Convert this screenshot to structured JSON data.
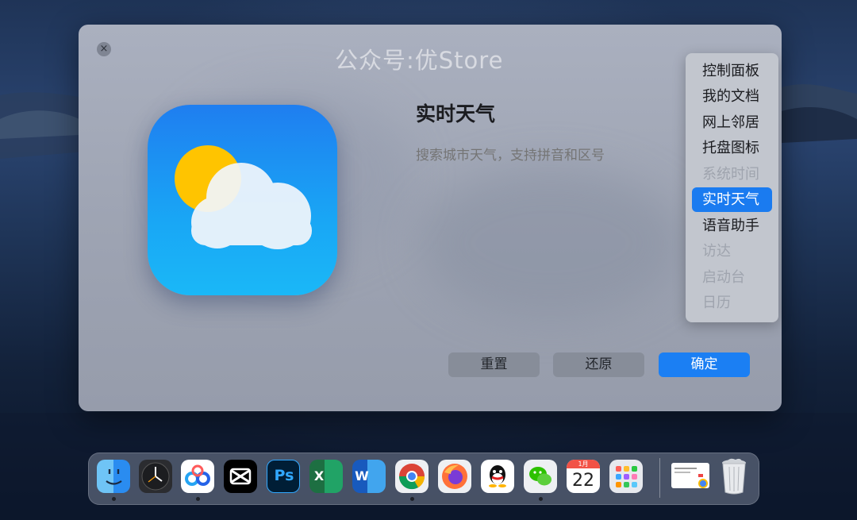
{
  "dialog": {
    "watermark": "公众号:优Store",
    "title": "实时天气",
    "search_placeholder": "搜索城市天气，支持拼音和区号",
    "buttons": {
      "reset": "重置",
      "restore": "还原",
      "ok": "确定"
    },
    "close_glyph": "×"
  },
  "menu": {
    "items": [
      {
        "label": "控制面板",
        "state": "normal"
      },
      {
        "label": "我的文档",
        "state": "normal"
      },
      {
        "label": "网上邻居",
        "state": "normal"
      },
      {
        "label": "托盘图标",
        "state": "normal"
      },
      {
        "label": "系统时间",
        "state": "disabled"
      },
      {
        "label": "实时天气",
        "state": "selected"
      },
      {
        "label": "语音助手",
        "state": "normal"
      },
      {
        "label": "访达",
        "state": "disabled"
      },
      {
        "label": "启动台",
        "state": "disabled"
      },
      {
        "label": "日历",
        "state": "disabled"
      }
    ]
  },
  "dock": {
    "apps": [
      {
        "icon": "finder-icon",
        "running": true
      },
      {
        "icon": "clock-icon",
        "running": false
      },
      {
        "icon": "baidu-netdisk-icon",
        "running": true
      },
      {
        "icon": "capcut-icon",
        "running": false
      },
      {
        "icon": "photoshop-icon",
        "label": "Ps",
        "running": false
      },
      {
        "icon": "excel-icon",
        "label": "X",
        "running": false
      },
      {
        "icon": "word-icon",
        "label": "W",
        "running": false
      },
      {
        "icon": "chrome-icon",
        "running": true
      },
      {
        "icon": "firefox-icon",
        "running": false
      },
      {
        "icon": "qq-icon",
        "running": false
      },
      {
        "icon": "wechat-icon",
        "running": true
      },
      {
        "icon": "calendar-icon",
        "month": "1月",
        "day": "22",
        "running": false
      },
      {
        "icon": "launchpad-icon",
        "running": false
      }
    ],
    "trailing": [
      {
        "icon": "document-preview-icon"
      },
      {
        "icon": "trash-icon"
      }
    ]
  },
  "colors": {
    "accent": "#1a7bf0",
    "weather_icon_top": "#1f7ef0",
    "weather_icon_bottom": "#1ab8f7",
    "sun": "#ffc400"
  }
}
